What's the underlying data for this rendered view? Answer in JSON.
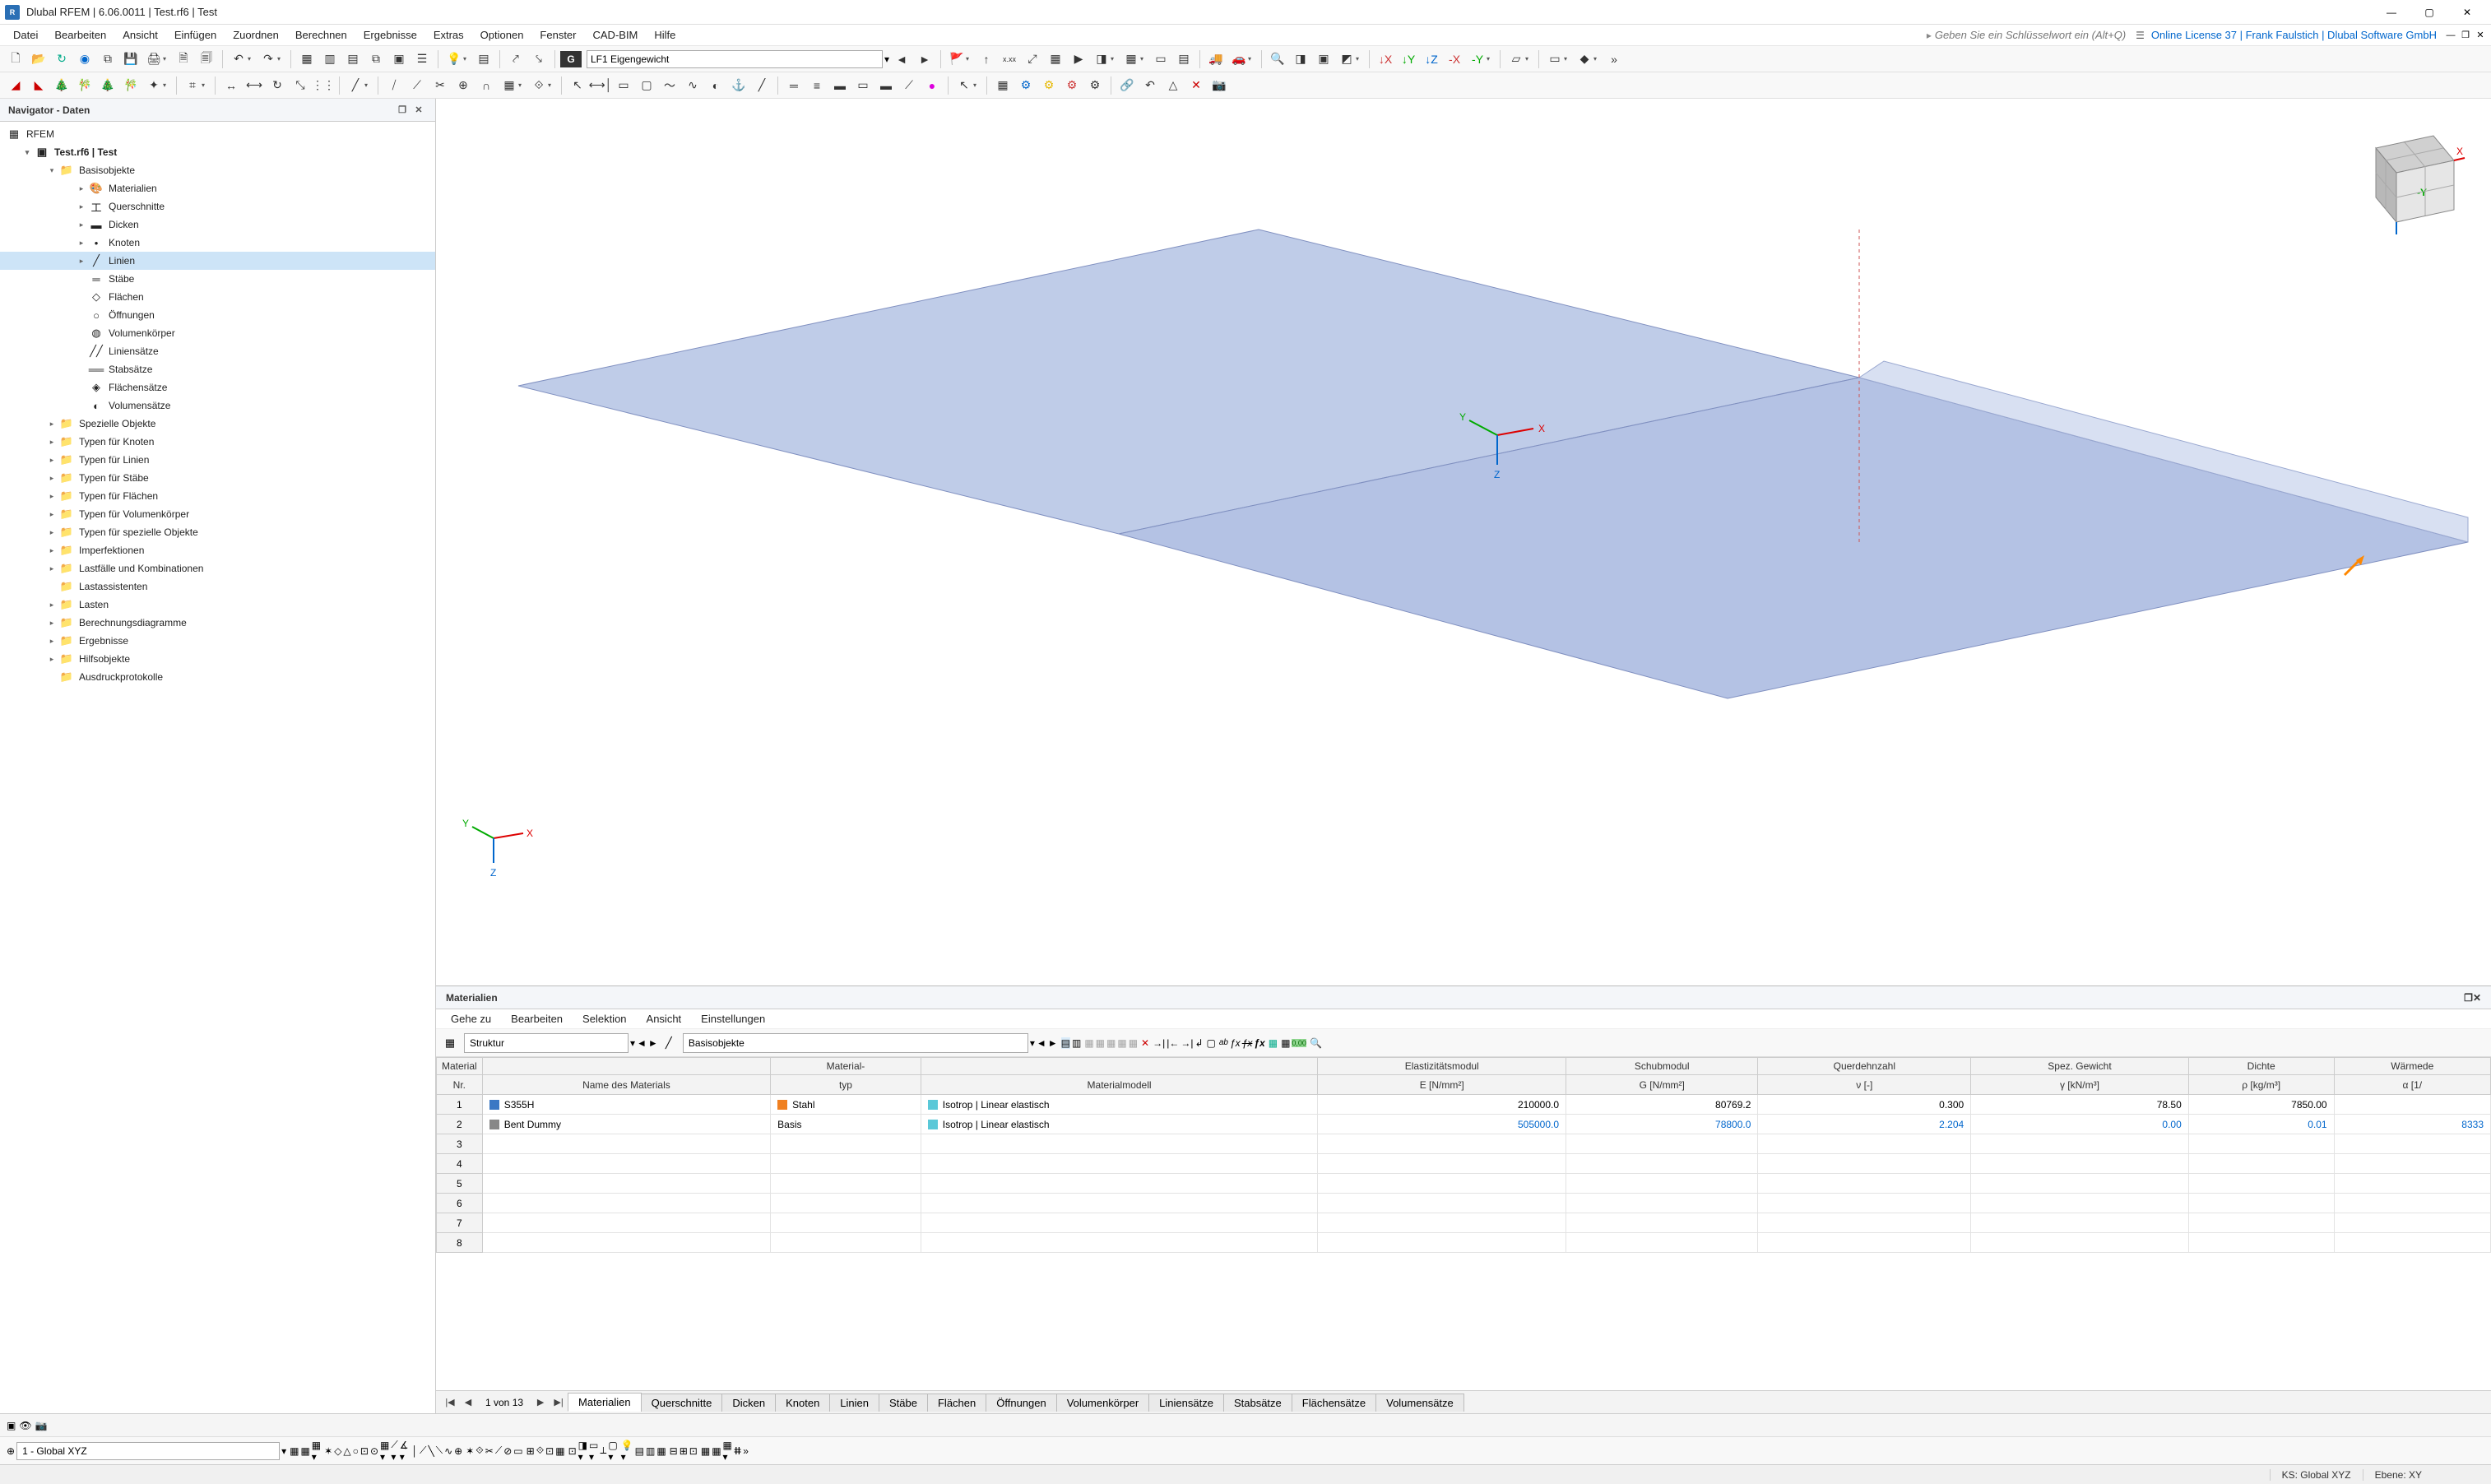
{
  "title": "Dlubal RFEM | 6.06.0011 | Test.rf6 | Test",
  "menus": [
    "Datei",
    "Bearbeiten",
    "Ansicht",
    "Einfügen",
    "Zuordnen",
    "Berechnen",
    "Ergebnisse",
    "Extras",
    "Optionen",
    "Fenster",
    "CAD-BIM",
    "Hilfe"
  ],
  "keyword_hint": "Geben Sie ein Schlüsselwort ein (Alt+Q)",
  "right_status": "Online License 37 | Frank Faulstich | Dlubal Software GmbH",
  "loadcase_field": "LF1   Eigengewicht",
  "navigator": {
    "title": "Navigator - Daten",
    "root": "RFEM",
    "project": "Test.rf6 | Test",
    "basis": "Basisobjekte",
    "basis_children": [
      "Materialien",
      "Querschnitte",
      "Dicken",
      "Knoten",
      "Linien",
      "Stäbe",
      "Flächen",
      "Öffnungen",
      "Volumenkörper",
      "Liniensätze",
      "Stabsätze",
      "Flächensätze",
      "Volumensätze"
    ],
    "basis_selected": "Linien",
    "other_folders": [
      "Spezielle Objekte",
      "Typen für Knoten",
      "Typen für Linien",
      "Typen für Stäbe",
      "Typen für Flächen",
      "Typen für Volumenkörper",
      "Typen für spezielle Objekte",
      "Imperfektionen",
      "Lastfälle und Kombinationen",
      "Lastassistenten",
      "Lasten",
      "Berechnungsdiagramme",
      "Ergebnisse",
      "Hilfsobjekte",
      "Ausdruckprotokolle"
    ]
  },
  "bottom": {
    "title": "Materialien",
    "menus": [
      "Gehe zu",
      "Bearbeiten",
      "Selektion",
      "Ansicht",
      "Einstellungen"
    ],
    "combo_left": "Struktur",
    "combo_right": "Basisobjekte",
    "page_info": "1 von 13",
    "columns": {
      "c0_top": "Material",
      "c0_sub": "Nr.",
      "c1_sub": "Name des Materials",
      "c2_top": "Material-",
      "c2_sub": "typ",
      "c3_sub": "Materialmodell",
      "c4_top": "Elastizitätsmodul",
      "c4_sub": "E [N/mm²]",
      "c5_top": "Schubmodul",
      "c5_sub": "G [N/mm²]",
      "c6_top": "Querdehnzahl",
      "c6_sub": "ν [-]",
      "c7_top": "Spez. Gewicht",
      "c7_sub": "γ [kN/m³]",
      "c8_top": "Dichte",
      "c8_sub": "ρ [kg/m³]",
      "c9_top": "Wärmede",
      "c9_sub": "α [1/"
    },
    "rows": [
      {
        "nr": "1",
        "name": "S355H",
        "typ": "Stahl",
        "modell": "Isotrop | Linear elastisch",
        "E": "210000.0",
        "G": "80769.2",
        "nu": "0.300",
        "gamma": "78.50",
        "rho": "7850.00",
        "alpha": "",
        "blue": false,
        "sw": "sw-blue",
        "tsw": "sw-orange",
        "msw": "sw-cyan"
      },
      {
        "nr": "2",
        "name": "Bent Dummy",
        "typ": "Basis",
        "modell": "Isotrop | Linear elastisch",
        "E": "505000.0",
        "G": "78800.0",
        "nu": "2.204",
        "gamma": "0.00",
        "rho": "0.01",
        "alpha": "8333",
        "blue": true,
        "sw": "sw-gray",
        "tsw": "",
        "msw": "sw-cyan"
      }
    ],
    "empty_rows": [
      "3",
      "4",
      "5",
      "6",
      "7",
      "8"
    ],
    "tabs": [
      "Materialien",
      "Querschnitte",
      "Dicken",
      "Knoten",
      "Linien",
      "Stäbe",
      "Flächen",
      "Öffnungen",
      "Volumenkörper",
      "Liniensätze",
      "Stabsätze",
      "Flächensätze",
      "Volumensätze"
    ],
    "active_tab": "Materialien"
  },
  "coord_combo": "1 - Global XYZ",
  "status": {
    "ks": "KS: Global XYZ",
    "ebene": "Ebene: XY"
  },
  "icons": {
    "app": "⧉",
    "min": "—",
    "max": "▢",
    "close": "✕",
    "new": "🗋",
    "open": "📂",
    "refresh": "↻",
    "cube": "◉",
    "copy": "⧉",
    "save": "💾",
    "print": "🖨",
    "doc1": "🗎",
    "doc2": "🗐",
    "undo": "↶",
    "redo": "↷",
    "grid": "▦",
    "table": "▥",
    "panel": "▤",
    "win": "⧉",
    "sheet": "▣",
    "props": "☰",
    "light": "💡",
    "layers": "▤",
    "ha": "⤤",
    "hb": "⤥",
    "gbtn": "G",
    "prev": "◄",
    "next": "►",
    "down": "▾",
    "render": "◳",
    "rot": "⟳",
    "iso": "◩",
    "front": "▢",
    "side": "▭",
    "top": "▱",
    "zoom": "🔍",
    "num": "⌗",
    "sel": "☐",
    "info": "ℹ",
    "move": "✥",
    "rot2": "↻",
    "arrow": "↗",
    "node": "•",
    "line": "╱",
    "member": "═",
    "surf": "▱",
    "opening": "◯",
    "solid": "◍",
    "clip": "▣",
    "cursor": "↖",
    "mesh": "▦",
    "gear": "⚙",
    "eye": "👁",
    "cam": "📷",
    "search": "🔍",
    "dock": "▣",
    "x": "✕",
    "bulb": "💡",
    "expand_open": "▾",
    "expand_closed": "▸",
    "first": "|◀",
    "last": "▶|",
    "lock": "🔒",
    "fx": "ƒx"
  }
}
